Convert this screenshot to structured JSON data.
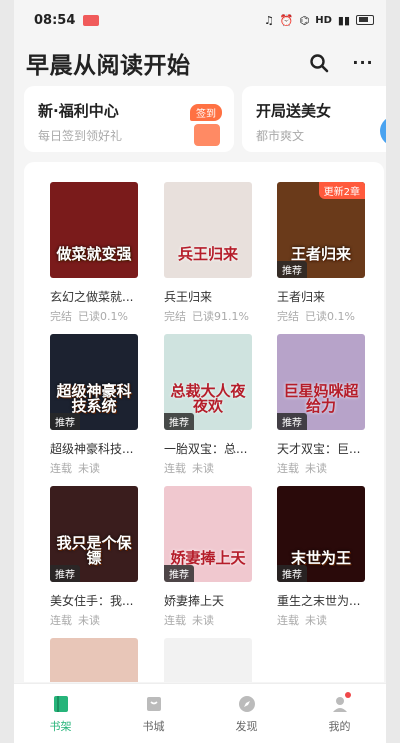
{
  "status_bar": {
    "time": "08:54",
    "network": "HD"
  },
  "header": {
    "title": "早晨从阅读开始",
    "search_icon": "search-icon",
    "more_icon": "more-icon"
  },
  "promos": [
    {
      "title": "新·福利中心",
      "subtitle": "每日签到领好礼",
      "tag": "签到"
    },
    {
      "title": "开局送美女",
      "subtitle": "都市爽文"
    }
  ],
  "books": [
    {
      "name": "玄幻之做菜就...",
      "serial": "完结",
      "progress": "已读0.1%",
      "cover_text": "做菜就变强",
      "cover_color": "#7a1b1b",
      "rec": ""
    },
    {
      "name": "兵王归来",
      "serial": "完结",
      "progress": "已读91.1%",
      "cover_text": "兵王归来",
      "cover_color": "#e8e0dc",
      "rec": ""
    },
    {
      "name": "王者归来",
      "serial": "完结",
      "progress": "已读0.1%",
      "cover_text": "王者归来",
      "cover_color": "#6a3a1a",
      "rec": "推荐",
      "update": "更新2章"
    },
    {
      "name": "超级神豪科技...",
      "serial": "连载",
      "progress": "未读",
      "cover_text": "超级神豪科技系统",
      "cover_color": "#1c2230",
      "rec": "推荐"
    },
    {
      "name": "一胎双宝：总...",
      "serial": "连载",
      "progress": "未读",
      "cover_text": "总裁大人夜夜欢",
      "cover_color": "#cfe3df",
      "rec": "推荐"
    },
    {
      "name": "天才双宝：巨...",
      "serial": "连载",
      "progress": "未读",
      "cover_text": "巨星妈咪超给力",
      "cover_color": "#b7a3c9",
      "rec": "推荐"
    },
    {
      "name": "美女住手：我...",
      "serial": "连载",
      "progress": "未读",
      "cover_text": "我只是个保镖",
      "cover_color": "#3a1d1d",
      "rec": "推荐"
    },
    {
      "name": "娇妻捧上天",
      "serial": "连载",
      "progress": "未读",
      "cover_text": "娇妻捧上天",
      "cover_color": "#f0c8cf",
      "rec": "推荐"
    },
    {
      "name": "重生之末世为...",
      "serial": "连载",
      "progress": "未读",
      "cover_text": "末世为王",
      "cover_color": "#2a0a0a",
      "rec": "推荐"
    },
    {
      "name": "",
      "serial": "",
      "progress": "",
      "cover_text": "",
      "cover_color": "#e8c6b8",
      "rec": ""
    },
    {
      "name": "",
      "serial": "",
      "progress": "",
      "cover_text": "",
      "cover_color": "#f2f2f2",
      "rec": ""
    }
  ],
  "tabs": [
    {
      "label": "书架",
      "icon": "bookshelf-icon",
      "active": true
    },
    {
      "label": "书城",
      "icon": "bookstore-icon",
      "active": false
    },
    {
      "label": "发现",
      "icon": "discover-icon",
      "active": false
    },
    {
      "label": "我的",
      "icon": "profile-icon",
      "active": false,
      "dot": true
    }
  ],
  "colors": {
    "accent": "#26b47a",
    "tag": "#ff7143",
    "badge": "#f0484a"
  }
}
